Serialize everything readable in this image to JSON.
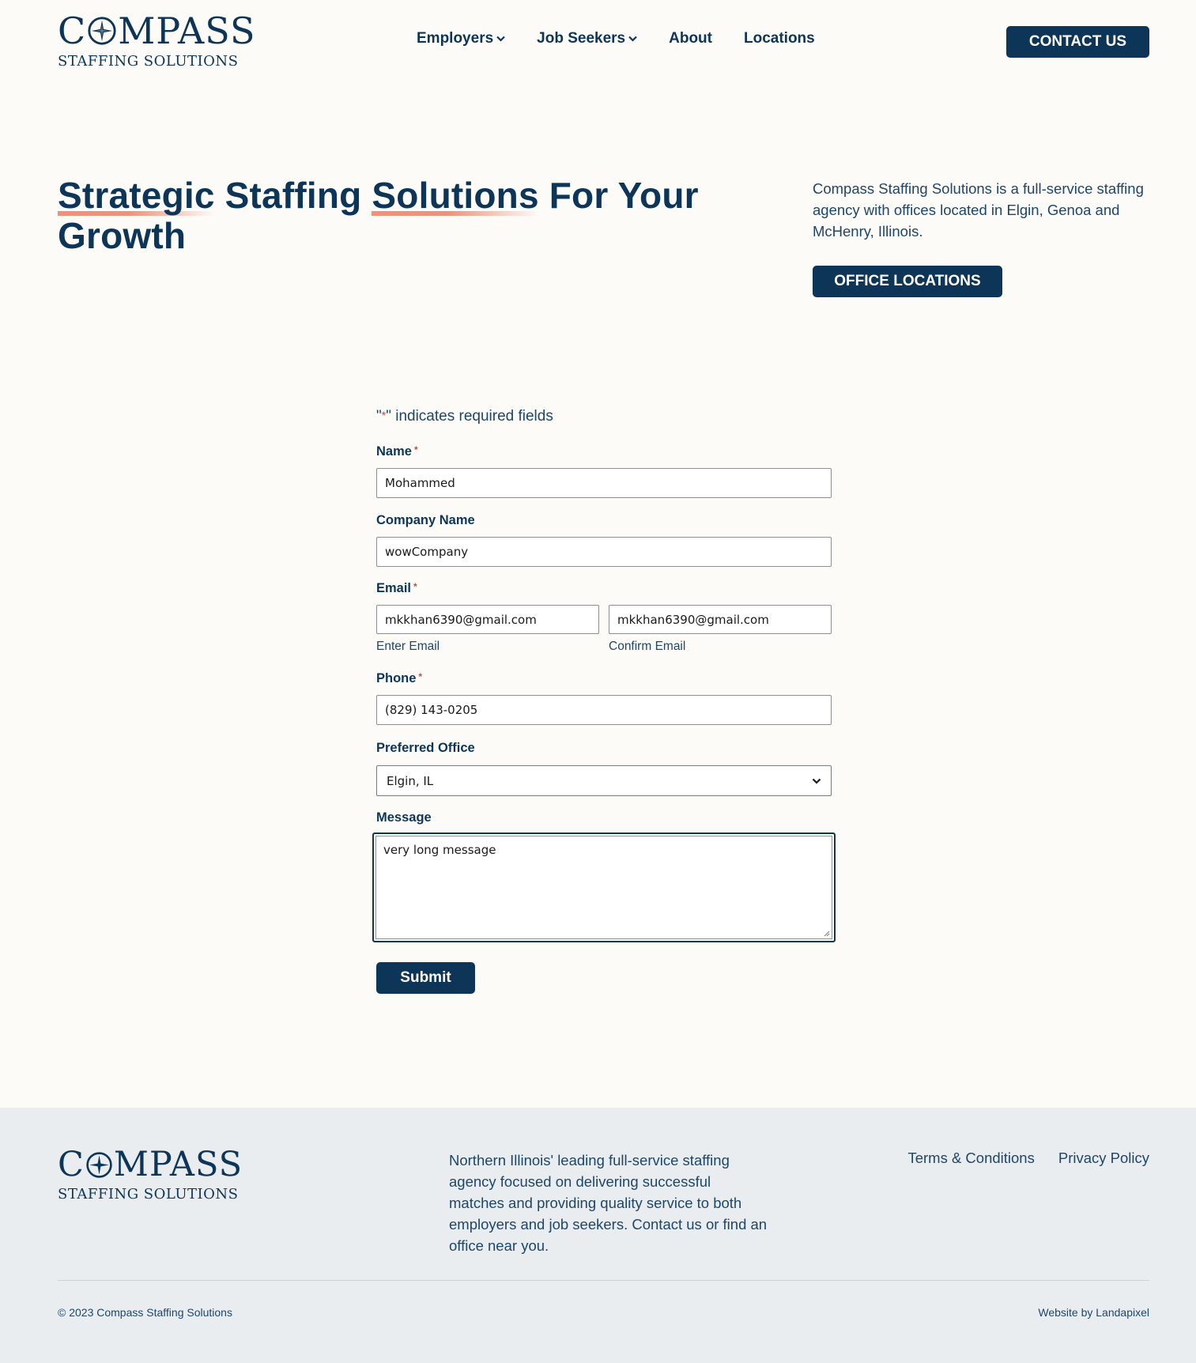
{
  "brand": {
    "logo_prefix": "C",
    "logo_suffix": "MPASS",
    "logo_sub": "STAFFING SOLUTIONS",
    "color_primary": "#0d3558",
    "color_accent": "#f0907a",
    "color_required": "#c0503c"
  },
  "nav": {
    "items": [
      {
        "label": "Employers",
        "has_dropdown": true
      },
      {
        "label": "Job Seekers",
        "has_dropdown": true
      },
      {
        "label": "About",
        "has_dropdown": false
      },
      {
        "label": "Locations",
        "has_dropdown": false
      }
    ],
    "contact_label": "CONTACT US"
  },
  "hero": {
    "title_part1": "Strategic",
    "title_part2": " Staffing ",
    "title_part3": "Solutions",
    "title_part4": " For Your Growth",
    "description": "Compass Staffing Solutions is a full-service staffing agency with offices located in Elgin, Genoa and McHenry, Illinois.",
    "button_label": "OFFICE LOCATIONS"
  },
  "form": {
    "required_note_open": "\"",
    "required_note_star": "*",
    "required_note_close": "\" indicates required fields",
    "name_label": "Name",
    "name_value": "Mohammed",
    "company_label": "Company Name",
    "company_value": "wowCompany",
    "email_label": "Email",
    "email_value": "mkkhan6390@gmail.com",
    "email_sublabel": "Enter Email",
    "confirm_email_value": "mkkhan6390@gmail.com",
    "confirm_email_sublabel": "Confirm Email",
    "phone_label": "Phone",
    "phone_value": "(829) 143-0205",
    "office_label": "Preferred Office",
    "office_selected": "Elgin, IL",
    "message_label": "Message",
    "message_value": "very long message",
    "required_star": "*",
    "submit_label": "Submit"
  },
  "footer": {
    "logo_prefix": "C",
    "logo_suffix": "MPASS",
    "logo_sub": "STAFFING SOLUTIONS",
    "description": "Northern Illinois' leading full-service staffing agency focused on delivering successful matches and providing quality service to both employers and job seekers. Contact us or find an office near you.",
    "links": [
      "Terms & Conditions",
      "Privacy Policy"
    ],
    "copyright": "©  2023  Compass Staffing Solutions",
    "credit": "Website by Landapixel"
  }
}
